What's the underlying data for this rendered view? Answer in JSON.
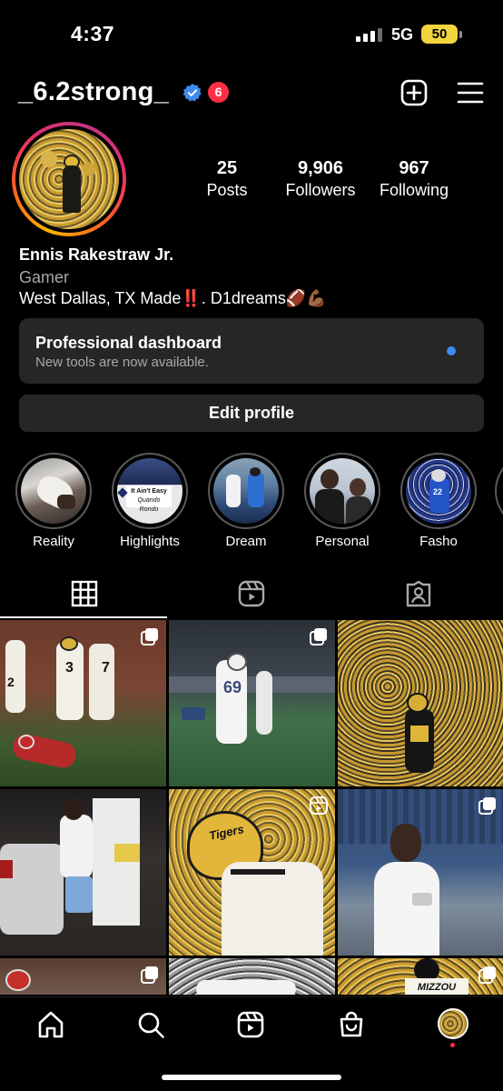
{
  "status_bar": {
    "time": "4:37",
    "network": "5G",
    "battery": "50"
  },
  "header": {
    "username": "_6.2strong_",
    "notification_count": "6"
  },
  "profile": {
    "stats": [
      {
        "value": "25",
        "label": "Posts"
      },
      {
        "value": "9,906",
        "label": "Followers"
      },
      {
        "value": "967",
        "label": "Following"
      }
    ],
    "name": "Ennis Rakestraw Jr.",
    "category": "Gamer",
    "bio": "West Dallas, TX Made‼️. D1dreams🏈💪🏾"
  },
  "dashboard": {
    "title": "Professional dashboard",
    "subtitle": "New tools are now available."
  },
  "edit_profile_label": "Edit profile",
  "highlights": [
    {
      "label": "Reality"
    },
    {
      "label": "Highlights",
      "overlay_text": "It Ain't Easy",
      "overlay_sub": "Quando Rondo"
    },
    {
      "label": "Dream"
    },
    {
      "label": "Personal"
    },
    {
      "label": "Fasho"
    }
  ],
  "grid": {
    "post_numbers": [
      "2",
      "3",
      "7",
      "69",
      "22"
    ],
    "team_text": "MIZZOU",
    "helmet_text": "Tigers"
  },
  "colors": {
    "accent_blue": "#3e8bf0",
    "badge_red": "#ff2f47",
    "battery_yellow": "#f2d53c",
    "mizzou_gold": "#e0b63a"
  }
}
